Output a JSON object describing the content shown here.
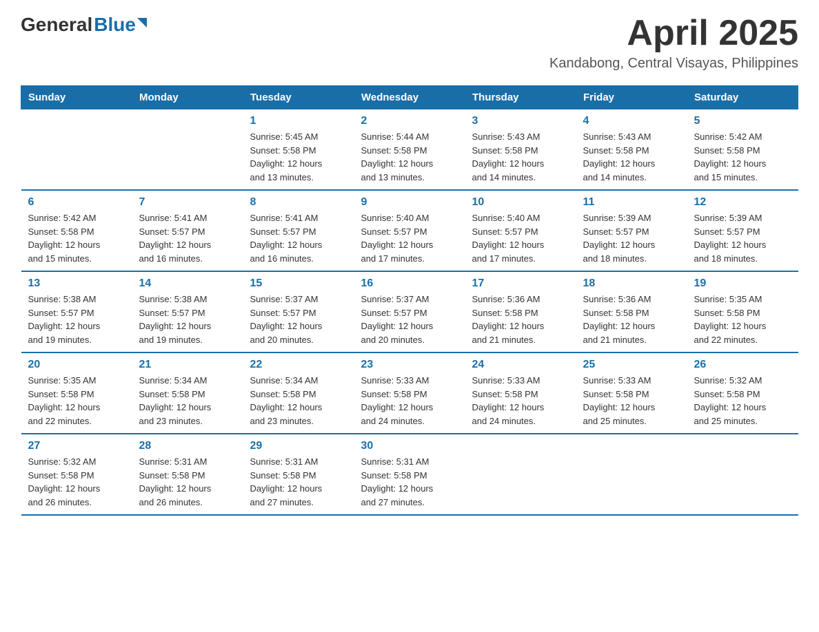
{
  "header": {
    "logo_general": "General",
    "logo_blue": "Blue",
    "month_title": "April 2025",
    "location": "Kandabong, Central Visayas, Philippines"
  },
  "calendar": {
    "days_of_week": [
      "Sunday",
      "Monday",
      "Tuesday",
      "Wednesday",
      "Thursday",
      "Friday",
      "Saturday"
    ],
    "weeks": [
      [
        {
          "day": "",
          "info": ""
        },
        {
          "day": "",
          "info": ""
        },
        {
          "day": "1",
          "info": "Sunrise: 5:45 AM\nSunset: 5:58 PM\nDaylight: 12 hours\nand 13 minutes."
        },
        {
          "day": "2",
          "info": "Sunrise: 5:44 AM\nSunset: 5:58 PM\nDaylight: 12 hours\nand 13 minutes."
        },
        {
          "day": "3",
          "info": "Sunrise: 5:43 AM\nSunset: 5:58 PM\nDaylight: 12 hours\nand 14 minutes."
        },
        {
          "day": "4",
          "info": "Sunrise: 5:43 AM\nSunset: 5:58 PM\nDaylight: 12 hours\nand 14 minutes."
        },
        {
          "day": "5",
          "info": "Sunrise: 5:42 AM\nSunset: 5:58 PM\nDaylight: 12 hours\nand 15 minutes."
        }
      ],
      [
        {
          "day": "6",
          "info": "Sunrise: 5:42 AM\nSunset: 5:58 PM\nDaylight: 12 hours\nand 15 minutes."
        },
        {
          "day": "7",
          "info": "Sunrise: 5:41 AM\nSunset: 5:57 PM\nDaylight: 12 hours\nand 16 minutes."
        },
        {
          "day": "8",
          "info": "Sunrise: 5:41 AM\nSunset: 5:57 PM\nDaylight: 12 hours\nand 16 minutes."
        },
        {
          "day": "9",
          "info": "Sunrise: 5:40 AM\nSunset: 5:57 PM\nDaylight: 12 hours\nand 17 minutes."
        },
        {
          "day": "10",
          "info": "Sunrise: 5:40 AM\nSunset: 5:57 PM\nDaylight: 12 hours\nand 17 minutes."
        },
        {
          "day": "11",
          "info": "Sunrise: 5:39 AM\nSunset: 5:57 PM\nDaylight: 12 hours\nand 18 minutes."
        },
        {
          "day": "12",
          "info": "Sunrise: 5:39 AM\nSunset: 5:57 PM\nDaylight: 12 hours\nand 18 minutes."
        }
      ],
      [
        {
          "day": "13",
          "info": "Sunrise: 5:38 AM\nSunset: 5:57 PM\nDaylight: 12 hours\nand 19 minutes."
        },
        {
          "day": "14",
          "info": "Sunrise: 5:38 AM\nSunset: 5:57 PM\nDaylight: 12 hours\nand 19 minutes."
        },
        {
          "day": "15",
          "info": "Sunrise: 5:37 AM\nSunset: 5:57 PM\nDaylight: 12 hours\nand 20 minutes."
        },
        {
          "day": "16",
          "info": "Sunrise: 5:37 AM\nSunset: 5:57 PM\nDaylight: 12 hours\nand 20 minutes."
        },
        {
          "day": "17",
          "info": "Sunrise: 5:36 AM\nSunset: 5:58 PM\nDaylight: 12 hours\nand 21 minutes."
        },
        {
          "day": "18",
          "info": "Sunrise: 5:36 AM\nSunset: 5:58 PM\nDaylight: 12 hours\nand 21 minutes."
        },
        {
          "day": "19",
          "info": "Sunrise: 5:35 AM\nSunset: 5:58 PM\nDaylight: 12 hours\nand 22 minutes."
        }
      ],
      [
        {
          "day": "20",
          "info": "Sunrise: 5:35 AM\nSunset: 5:58 PM\nDaylight: 12 hours\nand 22 minutes."
        },
        {
          "day": "21",
          "info": "Sunrise: 5:34 AM\nSunset: 5:58 PM\nDaylight: 12 hours\nand 23 minutes."
        },
        {
          "day": "22",
          "info": "Sunrise: 5:34 AM\nSunset: 5:58 PM\nDaylight: 12 hours\nand 23 minutes."
        },
        {
          "day": "23",
          "info": "Sunrise: 5:33 AM\nSunset: 5:58 PM\nDaylight: 12 hours\nand 24 minutes."
        },
        {
          "day": "24",
          "info": "Sunrise: 5:33 AM\nSunset: 5:58 PM\nDaylight: 12 hours\nand 24 minutes."
        },
        {
          "day": "25",
          "info": "Sunrise: 5:33 AM\nSunset: 5:58 PM\nDaylight: 12 hours\nand 25 minutes."
        },
        {
          "day": "26",
          "info": "Sunrise: 5:32 AM\nSunset: 5:58 PM\nDaylight: 12 hours\nand 25 minutes."
        }
      ],
      [
        {
          "day": "27",
          "info": "Sunrise: 5:32 AM\nSunset: 5:58 PM\nDaylight: 12 hours\nand 26 minutes."
        },
        {
          "day": "28",
          "info": "Sunrise: 5:31 AM\nSunset: 5:58 PM\nDaylight: 12 hours\nand 26 minutes."
        },
        {
          "day": "29",
          "info": "Sunrise: 5:31 AM\nSunset: 5:58 PM\nDaylight: 12 hours\nand 27 minutes."
        },
        {
          "day": "30",
          "info": "Sunrise: 5:31 AM\nSunset: 5:58 PM\nDaylight: 12 hours\nand 27 minutes."
        },
        {
          "day": "",
          "info": ""
        },
        {
          "day": "",
          "info": ""
        },
        {
          "day": "",
          "info": ""
        }
      ]
    ]
  }
}
